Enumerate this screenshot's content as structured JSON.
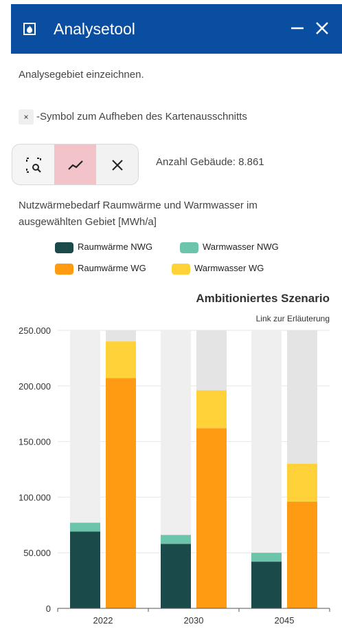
{
  "header": {
    "title": "Analysetool",
    "icon": "fire-home-icon",
    "minimize_icon": "minimize-icon",
    "close_icon": "close-icon",
    "bg": "#0a4ea1"
  },
  "intro": "Analysegebiet einzeichnen.",
  "clear_hint": {
    "symbol": "×",
    "text": "-Symbol zum Aufheben des Kartenausschnitts"
  },
  "toolbar": {
    "buttons": [
      {
        "icon": "select-area-icon",
        "active": false
      },
      {
        "icon": "line-chart-icon",
        "active": true
      },
      {
        "icon": "clear-icon",
        "active": false
      }
    ]
  },
  "building_count": "Anzahl Gebäude: 8.861",
  "description": [
    "Nutzwärmebedarf Raumwärme und Warmwasser im",
    "ausgewählten Gebiet [MWh/a]"
  ],
  "legend": [
    {
      "label": "Raumwärme NWG",
      "color": "#1a4a4a"
    },
    {
      "label": "Warmwasser NWG",
      "color": "#6cc5aa"
    },
    {
      "label": "Raumwärme WG",
      "color": "#ff9b12"
    },
    {
      "label": "Warmwasser WG",
      "color": "#ffd23a"
    }
  ],
  "chart_data": {
    "type": "bar",
    "title": "Ambitioniertes Szenario",
    "link": "Link zur Erläuterung",
    "categories": [
      "2022",
      "2030",
      "2045"
    ],
    "ylim": [
      0,
      250000
    ],
    "yticks": [
      "0",
      "50.000",
      "100.000",
      "150.000",
      "200.000",
      "250.000"
    ],
    "ytick_values": [
      0,
      50000,
      100000,
      150000,
      200000,
      250000
    ],
    "background_color": "#efefef",
    "groups": [
      {
        "name": "NWG",
        "series": [
          {
            "name": "Raumwärme NWG",
            "color": "#1a4a4a",
            "values": [
              69000,
              58000,
              42000
            ]
          },
          {
            "name": "Warmwasser NWG",
            "color": "#6cc5aa",
            "values": [
              8000,
              8000,
              8000
            ]
          }
        ]
      },
      {
        "name": "WG",
        "series": [
          {
            "name": "Raumwärme WG",
            "color": "#ff9b12",
            "values": [
              207000,
              162000,
              96000
            ]
          },
          {
            "name": "Warmwasser WG",
            "color": "#ffd23a",
            "values": [
              33000,
              34000,
              34000
            ]
          }
        ]
      }
    ]
  }
}
